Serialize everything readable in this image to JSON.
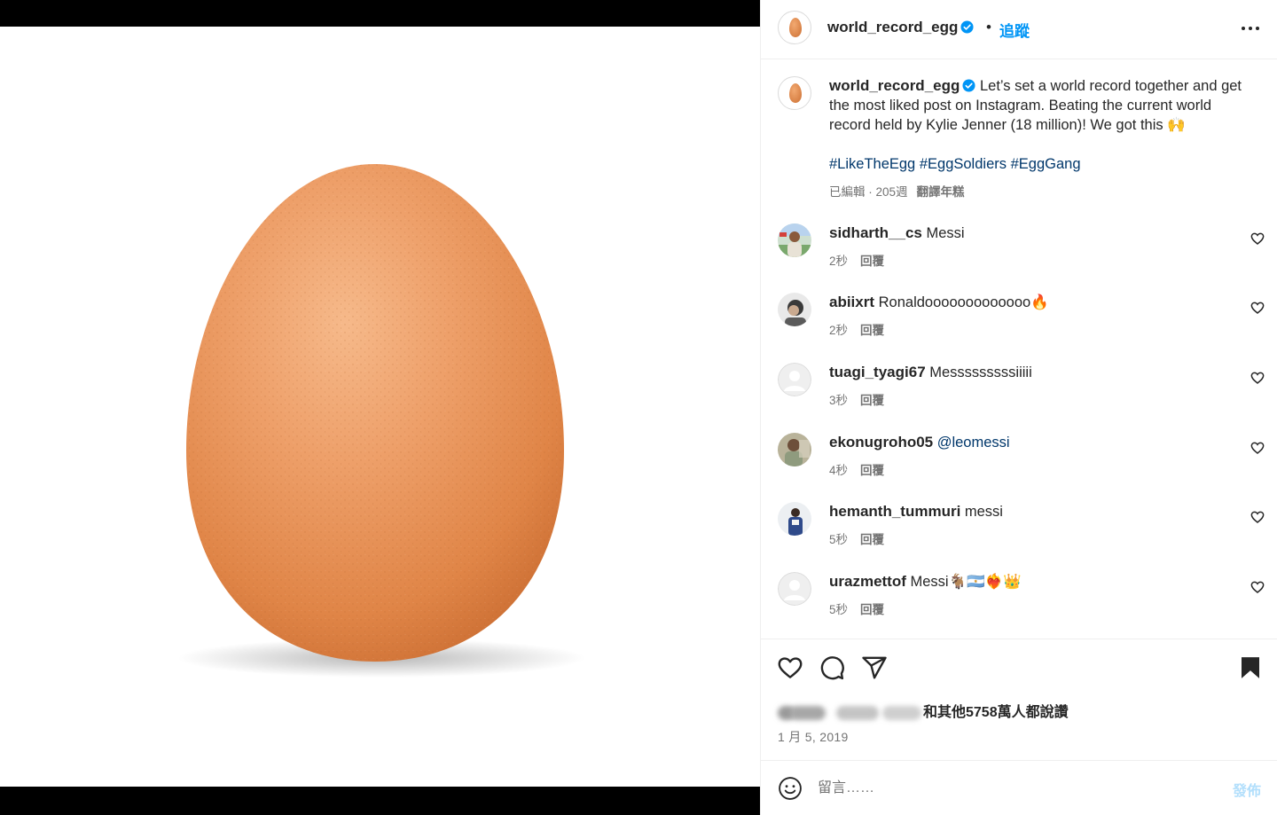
{
  "post": {
    "username": "world_record_egg",
    "follow_label": "追蹤",
    "separator": "•",
    "more_icon": "more-horizontal-icon",
    "caption": "Let’s set a world record together and get the most liked post on Instagram. Beating the current world record held by Kylie Jenner (18 million)! We got this 🙌",
    "hashtags": [
      "#LikeTheEgg",
      "#EggSoldiers",
      "#EggGang"
    ],
    "edited_time": "已編輯 · 205週",
    "translate_label": "翻譯年糕"
  },
  "comments": [
    {
      "username": "sidharth__cs",
      "text": "Messi",
      "time": "2秒",
      "reply": "回覆"
    },
    {
      "username": "abiixrt",
      "text": "Ronaldooooooooooooo🔥",
      "time": "2秒",
      "reply": "回覆"
    },
    {
      "username": "tuagi_tyagi67",
      "text": "Messsssssssiiiii",
      "time": "3秒",
      "reply": "回覆"
    },
    {
      "username": "ekonugroho05",
      "text": "@leomessi",
      "time": "4秒",
      "reply": "回覆"
    },
    {
      "username": "hemanth_tummuri",
      "text": "messi",
      "time": "5秒",
      "reply": "回覆"
    },
    {
      "username": "urazmettof",
      "text": "Messi🐐🇦🇷❤️‍🔥👑",
      "time": "5秒",
      "reply": "回覆"
    }
  ],
  "actions": {
    "likes_text": "和其他5758萬人都說讚",
    "date": "1 月 5, 2019"
  },
  "composer": {
    "placeholder": "留言……",
    "post_label": "發佈"
  },
  "colors": {
    "accent": "#0095f6",
    "link": "#00376b",
    "post_disabled": "#b2dffc",
    "secondary_text": "#737373"
  }
}
